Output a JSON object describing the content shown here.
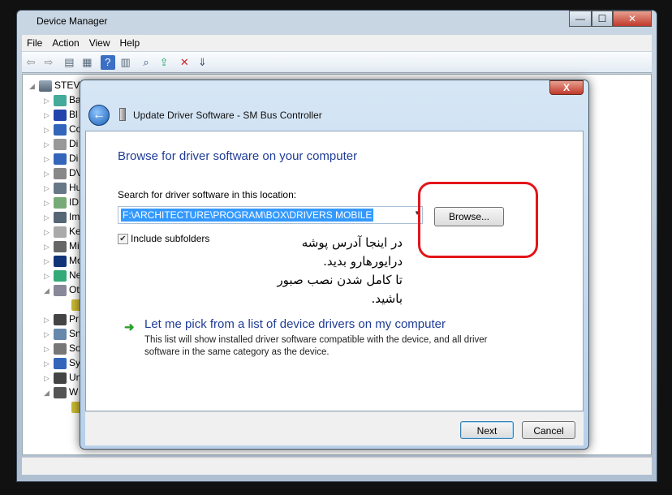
{
  "window": {
    "title": "Device Manager",
    "controls": [
      "—",
      "☐",
      "✕"
    ]
  },
  "menu": [
    "File",
    "Action",
    "View",
    "Help"
  ],
  "toolbar_icons": [
    "back-icon",
    "forward-icon",
    "show-hide-tree-icon",
    "properties-icon",
    "help-icon",
    "details-icon",
    "scan-hardware-icon",
    "update-driver-icon",
    "disable-device-icon",
    "uninstall-icon"
  ],
  "tree": {
    "root": "STEVE",
    "items": [
      {
        "label": "Ba",
        "state": "collapsed"
      },
      {
        "label": "Bl",
        "state": "collapsed"
      },
      {
        "label": "Co",
        "state": "collapsed"
      },
      {
        "label": "Di",
        "state": "collapsed"
      },
      {
        "label": "Di",
        "state": "collapsed"
      },
      {
        "label": "DV",
        "state": "collapsed"
      },
      {
        "label": "Hu",
        "state": "collapsed"
      },
      {
        "label": "ID",
        "state": "collapsed"
      },
      {
        "label": "Im",
        "state": "collapsed"
      },
      {
        "label": "Ke",
        "state": "collapsed"
      },
      {
        "label": "Mi",
        "state": "collapsed"
      },
      {
        "label": "Mo",
        "state": "collapsed"
      },
      {
        "label": "Ne",
        "state": "collapsed"
      },
      {
        "label": "Ot",
        "state": "expanded"
      },
      {
        "label": "",
        "state": "child"
      },
      {
        "label": "Pr",
        "state": "collapsed"
      },
      {
        "label": "Sn",
        "state": "collapsed"
      },
      {
        "label": "So",
        "state": "collapsed"
      },
      {
        "label": "Sy",
        "state": "collapsed"
      },
      {
        "label": "Un",
        "state": "collapsed"
      },
      {
        "label": "W",
        "state": "expanded"
      },
      {
        "label": "",
        "state": "child"
      }
    ]
  },
  "dialog": {
    "title": "Update Driver Software - SM Bus Controller",
    "close": "X",
    "heading": "Browse for driver software on your computer",
    "search_label": "Search for driver software in this location:",
    "path_value": "F:\\ARCHITECTURE\\PROGRAM\\BOX\\DRIVERS MOBILE",
    "browse": "Browse...",
    "include_subfolders": "Include subfolders",
    "include_subfolders_checked": true,
    "annotation_lines": [
      "در اینجا آدرس پوشه",
      "درایورهارو بدید.",
      "تا کامل شدن نصب صبور",
      "باشید."
    ],
    "annotation_color": "#e3161b",
    "pick_title": "Let me pick from a list of device drivers on my computer",
    "pick_desc": "This list will show installed driver software compatible with the device, and all driver software in the same category as the device.",
    "next": "Next",
    "cancel": "Cancel"
  }
}
